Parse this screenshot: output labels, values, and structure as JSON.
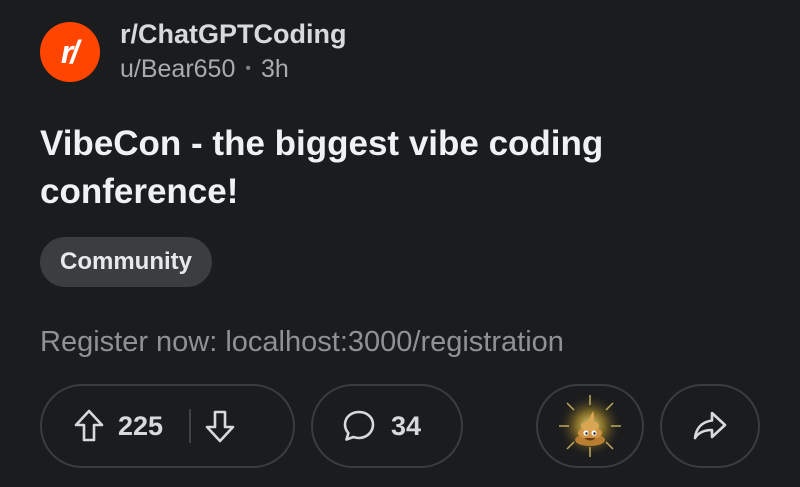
{
  "post": {
    "subreddit": {
      "name": "r/ChatGPTCoding",
      "avatar_text": "r/",
      "avatar_color": "#ff4500"
    },
    "author": "u/Bear650",
    "separator": "•",
    "time_ago": "3h",
    "title": "VibeCon - the biggest vibe coding conference!",
    "flair": "Community",
    "body": "Register now: localhost:3000/registration"
  },
  "actions": {
    "upvote_icon": "arrow-up-icon",
    "upvotes": "225",
    "downvote_icon": "arrow-down-icon",
    "comment_icon": "speech-bubble-icon",
    "comments": "34",
    "award_icon": "poop-award-icon",
    "share_icon": "share-arrow-icon"
  },
  "colors": {
    "background": "#1b1c1e",
    "accent": "#ff4500",
    "flair_bg": "#3b3d40",
    "border": "#3a3c40"
  }
}
